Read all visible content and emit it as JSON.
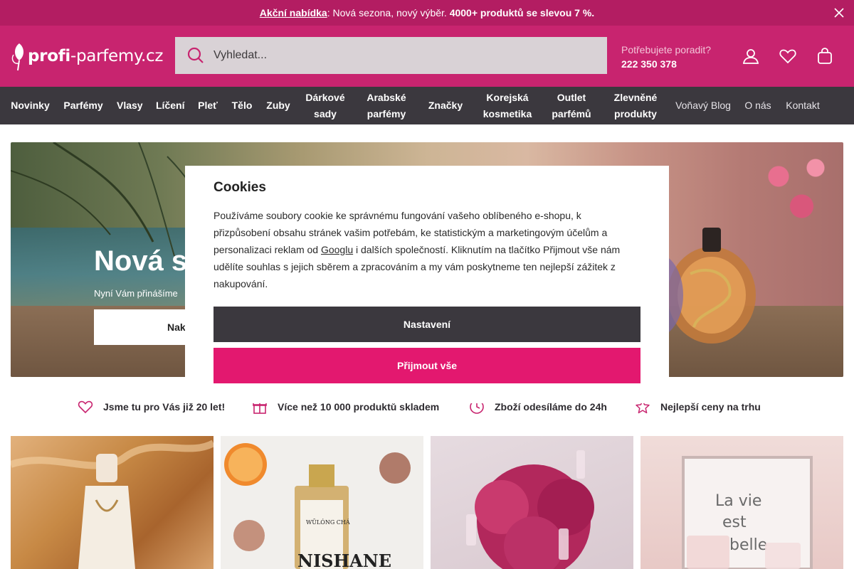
{
  "promo": {
    "link": "Akční nabídka",
    "text": ": Nová sezona, nový výběr. ",
    "highlight": "4000+ produktů se slevou 7 %.",
    "close_icon": "close-icon"
  },
  "header": {
    "logo_bold": "profi",
    "logo_rest": "-parfemy.cz",
    "search_placeholder": "Vyhledat...",
    "help_label": "Potřebujete poradit?",
    "help_phone": "222 350 378",
    "icons": [
      "user-icon",
      "heart-icon",
      "bag-icon"
    ]
  },
  "nav": {
    "items": [
      {
        "label": "Novinky"
      },
      {
        "label": "Parfémy"
      },
      {
        "label": "Vlasy"
      },
      {
        "label": "Líčení"
      },
      {
        "label": "Pleť"
      },
      {
        "label": "Tělo"
      },
      {
        "label": "Zuby"
      },
      {
        "label": "Dárkové sady"
      },
      {
        "label": "Arabské parfémy"
      },
      {
        "label": "Značky"
      },
      {
        "label": "Korejská kosmetika"
      },
      {
        "label": "Outlet parfémů"
      },
      {
        "label": "Zlevněné produkty"
      },
      {
        "label": "Voňavý Blog"
      },
      {
        "label": "O nás"
      },
      {
        "label": "Kontakt"
      }
    ]
  },
  "hero": {
    "title": "Nová s",
    "subtitle": "Nyní Vám přinášíme",
    "button": "Nak"
  },
  "benefits": [
    {
      "icon": "heart-icon",
      "label": "Jsme tu pro Vás již 20 let!"
    },
    {
      "icon": "gift-icon",
      "label": "Více než 10 000 produktů skladem"
    },
    {
      "icon": "clock-icon",
      "label": "Zboží odesíláme do 24h"
    },
    {
      "icon": "star-icon",
      "label": "Nejlepší ceny na trhu"
    }
  ],
  "cookies": {
    "title": "Cookies",
    "text_before": "Používáme soubory cookie ke správnému fungování vašeho oblíbeného e-shopu, k přizpůsobení obsahu stránek vašim potřebám, ke statistickým a marketingovým účelům a personalizaci reklam od ",
    "link": "Googlu",
    "text_after": " i dalších společností. Kliknutím na tlačítko Přijmout vše nám udělíte souhlas s jejich sběrem a zpracováním a my vám poskytneme ten nejlepší zážitek z nakupování.",
    "settings_button": "Nastavení",
    "accept_button": "Přijmout vše"
  },
  "colors": {
    "brand": "#c8246f",
    "promo": "#b31d62",
    "nav": "#3b383e",
    "accept": "#e3186f"
  }
}
